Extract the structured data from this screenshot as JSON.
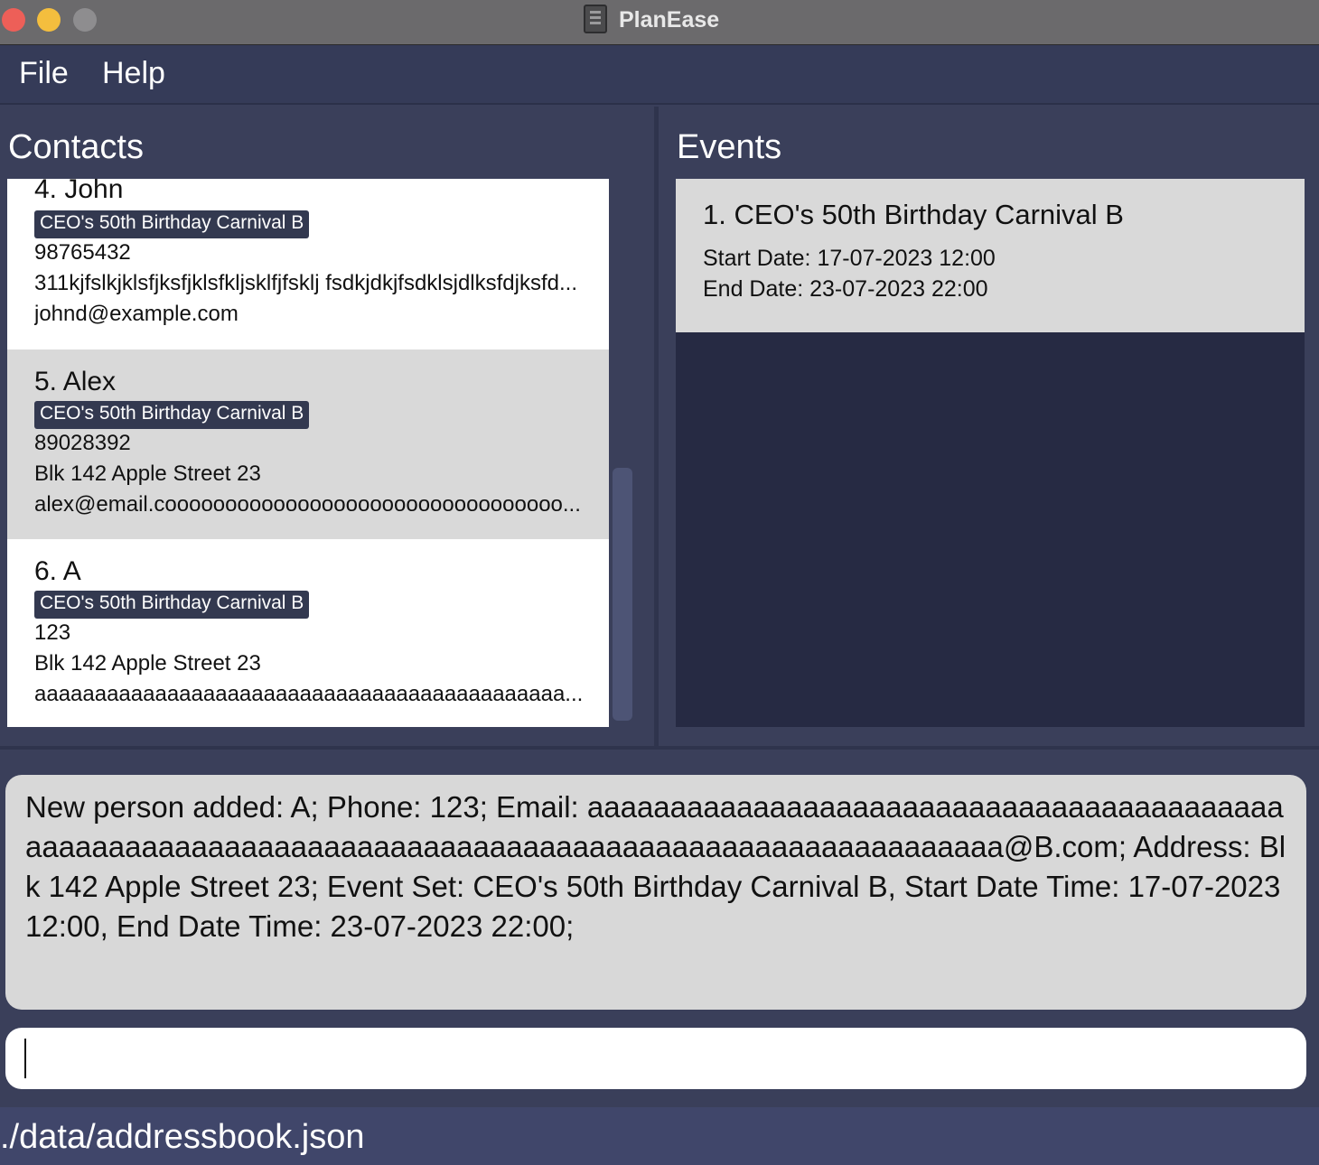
{
  "window": {
    "title": "PlanEase"
  },
  "menu": {
    "file": "File",
    "help": "Help"
  },
  "contacts": {
    "title": "Contacts",
    "items": [
      {
        "index_name": "4.  John",
        "tag": "CEO's 50th Birthday Carnival B",
        "phone": "98765432",
        "address": "311kjfslkjklsfjksfjklsfkljsklfjfsklj fsdkjdkjfsdklsjdlksfdjksfd...",
        "email": "johnd@example.com"
      },
      {
        "index_name": "5.  Alex",
        "tag": "CEO's 50th Birthday Carnival B",
        "phone": "89028392",
        "address": "Blk 142 Apple Street 23",
        "email": "alex@email.cooooooooooooooooooooooooooooooooo..."
      },
      {
        "index_name": "6.  A",
        "tag": "CEO's 50th Birthday Carnival B",
        "phone": "123",
        "address": "Blk 142 Apple Street 23",
        "email": "aaaaaaaaaaaaaaaaaaaaaaaaaaaaaaaaaaaaaaaaaaaa..."
      }
    ]
  },
  "events": {
    "title": "Events",
    "items": [
      {
        "index_name": "1.  CEO's 50th Birthday Carnival B",
        "start": "Start Date: 17-07-2023 12:00",
        "end": "End Date: 23-07-2023 22:00"
      }
    ]
  },
  "result": {
    "text": "New person added: A; Phone: 123; Email: aaaaaaaaaaaaaaaaaaaaaaaaaaaaaaaaaaaaaaaaaaaaaaaaaaaaaaaaaaaaaaaaaaaaaaaaaaaaaaaaaaaaaaaaaaaaaaaaaaaaa@B.com; Address: Blk 142 Apple Street 23; Event Set: CEO's 50th Birthday Carnival B, Start Date Time: 17-07-2023 12:00, End Date Time: 23-07-2023 22:00;"
  },
  "command": {
    "value": "",
    "placeholder": ""
  },
  "status": {
    "path": "./data/addressbook.json"
  },
  "colors": {
    "background": "#3a3f5a",
    "tag_bg": "#333950",
    "card_alt": "#d9d9d9",
    "event_list_bg": "#262a43"
  }
}
